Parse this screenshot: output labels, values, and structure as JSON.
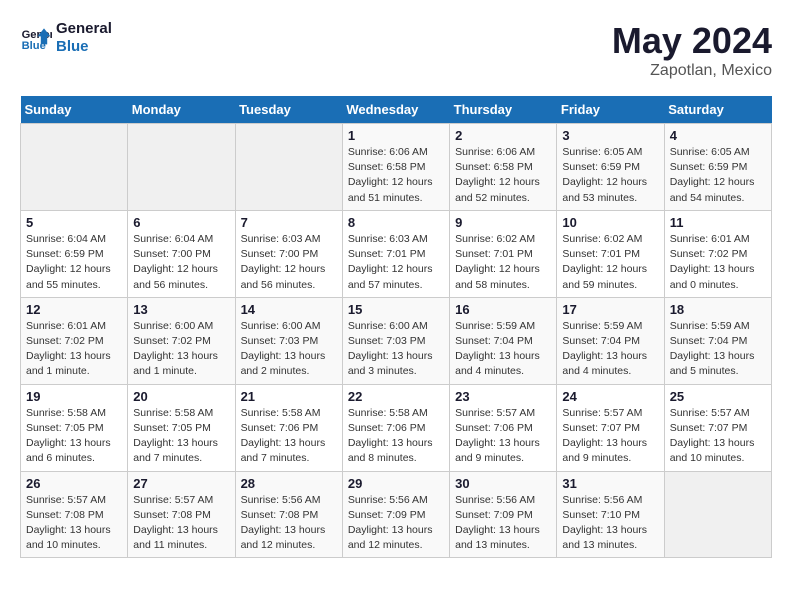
{
  "header": {
    "logo_line1": "General",
    "logo_line2": "Blue",
    "month": "May 2024",
    "location": "Zapotlan, Mexico"
  },
  "weekdays": [
    "Sunday",
    "Monday",
    "Tuesday",
    "Wednesday",
    "Thursday",
    "Friday",
    "Saturday"
  ],
  "weeks": [
    [
      {
        "day": "",
        "info": ""
      },
      {
        "day": "",
        "info": ""
      },
      {
        "day": "",
        "info": ""
      },
      {
        "day": "1",
        "info": "Sunrise: 6:06 AM\nSunset: 6:58 PM\nDaylight: 12 hours\nand 51 minutes."
      },
      {
        "day": "2",
        "info": "Sunrise: 6:06 AM\nSunset: 6:58 PM\nDaylight: 12 hours\nand 52 minutes."
      },
      {
        "day": "3",
        "info": "Sunrise: 6:05 AM\nSunset: 6:59 PM\nDaylight: 12 hours\nand 53 minutes."
      },
      {
        "day": "4",
        "info": "Sunrise: 6:05 AM\nSunset: 6:59 PM\nDaylight: 12 hours\nand 54 minutes."
      }
    ],
    [
      {
        "day": "5",
        "info": "Sunrise: 6:04 AM\nSunset: 6:59 PM\nDaylight: 12 hours\nand 55 minutes."
      },
      {
        "day": "6",
        "info": "Sunrise: 6:04 AM\nSunset: 7:00 PM\nDaylight: 12 hours\nand 56 minutes."
      },
      {
        "day": "7",
        "info": "Sunrise: 6:03 AM\nSunset: 7:00 PM\nDaylight: 12 hours\nand 56 minutes."
      },
      {
        "day": "8",
        "info": "Sunrise: 6:03 AM\nSunset: 7:01 PM\nDaylight: 12 hours\nand 57 minutes."
      },
      {
        "day": "9",
        "info": "Sunrise: 6:02 AM\nSunset: 7:01 PM\nDaylight: 12 hours\nand 58 minutes."
      },
      {
        "day": "10",
        "info": "Sunrise: 6:02 AM\nSunset: 7:01 PM\nDaylight: 12 hours\nand 59 minutes."
      },
      {
        "day": "11",
        "info": "Sunrise: 6:01 AM\nSunset: 7:02 PM\nDaylight: 13 hours\nand 0 minutes."
      }
    ],
    [
      {
        "day": "12",
        "info": "Sunrise: 6:01 AM\nSunset: 7:02 PM\nDaylight: 13 hours\nand 1 minute."
      },
      {
        "day": "13",
        "info": "Sunrise: 6:00 AM\nSunset: 7:02 PM\nDaylight: 13 hours\nand 1 minute."
      },
      {
        "day": "14",
        "info": "Sunrise: 6:00 AM\nSunset: 7:03 PM\nDaylight: 13 hours\nand 2 minutes."
      },
      {
        "day": "15",
        "info": "Sunrise: 6:00 AM\nSunset: 7:03 PM\nDaylight: 13 hours\nand 3 minutes."
      },
      {
        "day": "16",
        "info": "Sunrise: 5:59 AM\nSunset: 7:04 PM\nDaylight: 13 hours\nand 4 minutes."
      },
      {
        "day": "17",
        "info": "Sunrise: 5:59 AM\nSunset: 7:04 PM\nDaylight: 13 hours\nand 4 minutes."
      },
      {
        "day": "18",
        "info": "Sunrise: 5:59 AM\nSunset: 7:04 PM\nDaylight: 13 hours\nand 5 minutes."
      }
    ],
    [
      {
        "day": "19",
        "info": "Sunrise: 5:58 AM\nSunset: 7:05 PM\nDaylight: 13 hours\nand 6 minutes."
      },
      {
        "day": "20",
        "info": "Sunrise: 5:58 AM\nSunset: 7:05 PM\nDaylight: 13 hours\nand 7 minutes."
      },
      {
        "day": "21",
        "info": "Sunrise: 5:58 AM\nSunset: 7:06 PM\nDaylight: 13 hours\nand 7 minutes."
      },
      {
        "day": "22",
        "info": "Sunrise: 5:58 AM\nSunset: 7:06 PM\nDaylight: 13 hours\nand 8 minutes."
      },
      {
        "day": "23",
        "info": "Sunrise: 5:57 AM\nSunset: 7:06 PM\nDaylight: 13 hours\nand 9 minutes."
      },
      {
        "day": "24",
        "info": "Sunrise: 5:57 AM\nSunset: 7:07 PM\nDaylight: 13 hours\nand 9 minutes."
      },
      {
        "day": "25",
        "info": "Sunrise: 5:57 AM\nSunset: 7:07 PM\nDaylight: 13 hours\nand 10 minutes."
      }
    ],
    [
      {
        "day": "26",
        "info": "Sunrise: 5:57 AM\nSunset: 7:08 PM\nDaylight: 13 hours\nand 10 minutes."
      },
      {
        "day": "27",
        "info": "Sunrise: 5:57 AM\nSunset: 7:08 PM\nDaylight: 13 hours\nand 11 minutes."
      },
      {
        "day": "28",
        "info": "Sunrise: 5:56 AM\nSunset: 7:08 PM\nDaylight: 13 hours\nand 12 minutes."
      },
      {
        "day": "29",
        "info": "Sunrise: 5:56 AM\nSunset: 7:09 PM\nDaylight: 13 hours\nand 12 minutes."
      },
      {
        "day": "30",
        "info": "Sunrise: 5:56 AM\nSunset: 7:09 PM\nDaylight: 13 hours\nand 13 minutes."
      },
      {
        "day": "31",
        "info": "Sunrise: 5:56 AM\nSunset: 7:10 PM\nDaylight: 13 hours\nand 13 minutes."
      },
      {
        "day": "",
        "info": ""
      }
    ]
  ]
}
